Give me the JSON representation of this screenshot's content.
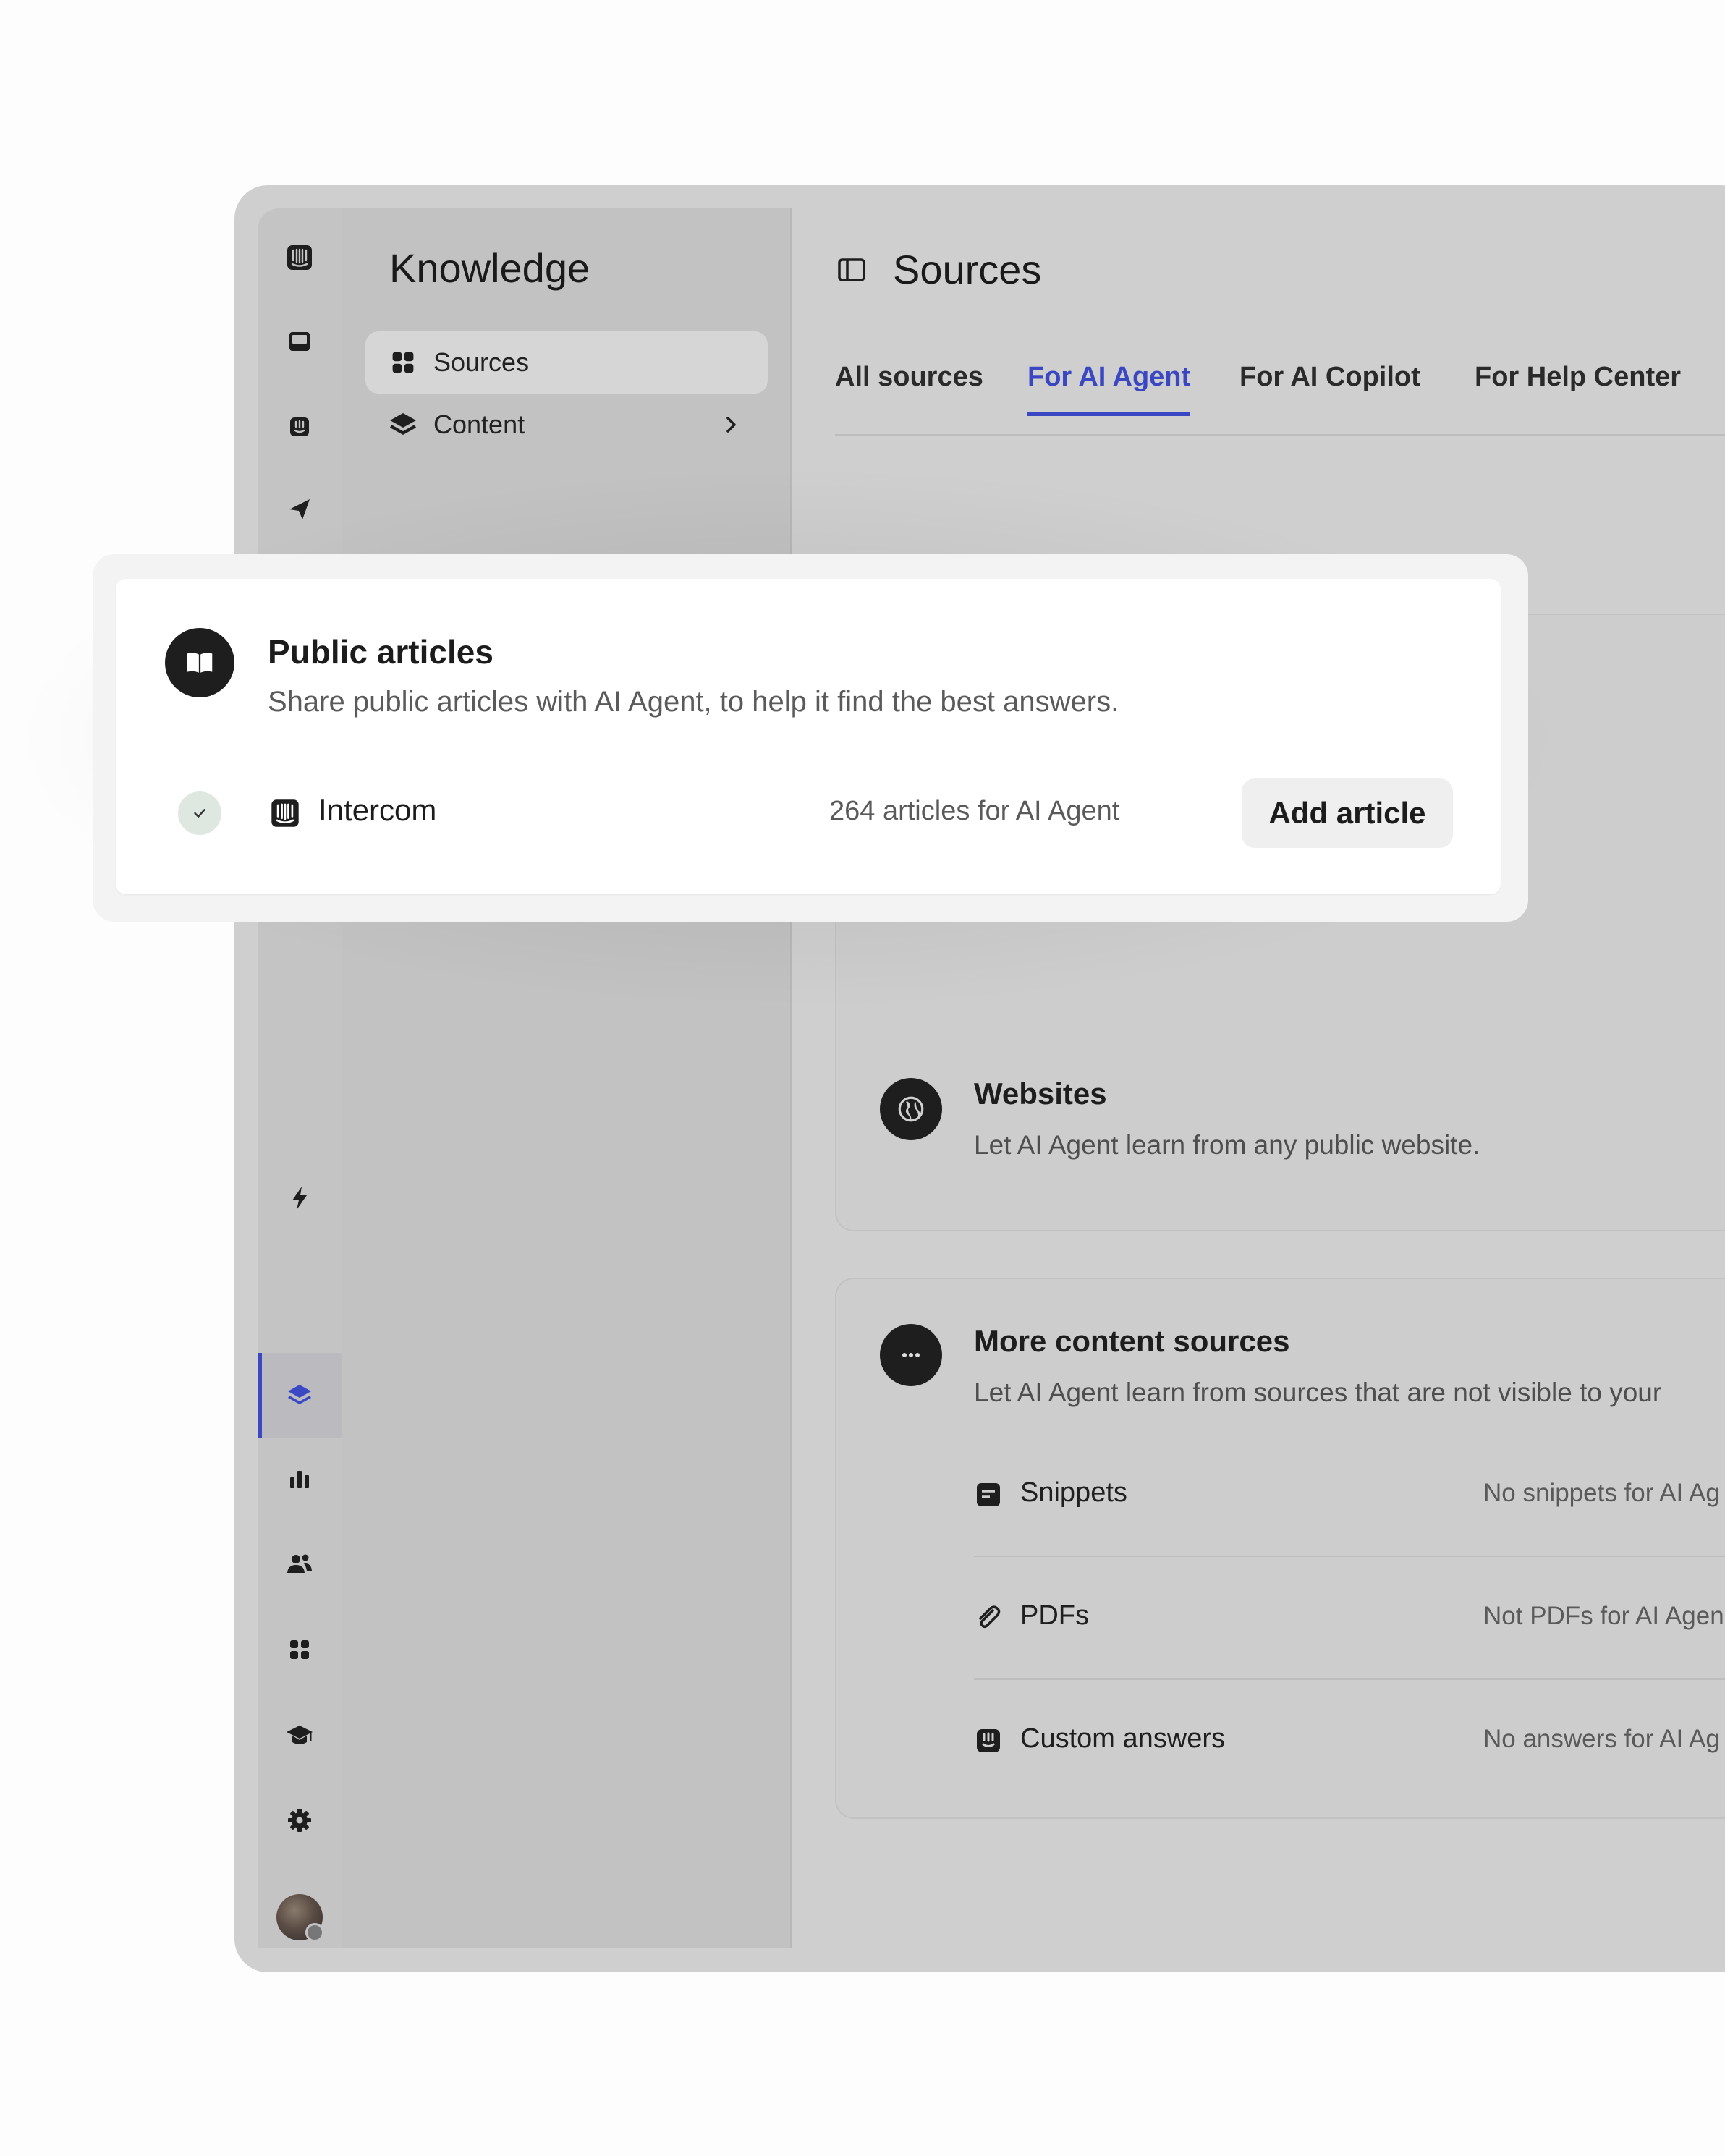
{
  "sidebar": {
    "top_icons": [
      "intercom-logo-icon",
      "inbox-icon",
      "fin-icon",
      "outbound-icon"
    ],
    "bottom_icons": [
      "lightning-icon",
      "knowledge-layers-icon",
      "reports-icon",
      "contacts-icon",
      "apps-icon",
      "academy-icon",
      "settings-icon"
    ],
    "active_item": "knowledge-layers-icon",
    "accent_color": "#3b48c4"
  },
  "nav": {
    "title": "Knowledge",
    "items": [
      {
        "label": "Sources",
        "icon": "grid-icon",
        "selected": true
      },
      {
        "label": "Content",
        "icon": "layers-icon",
        "selected": false
      }
    ]
  },
  "main": {
    "title": "Sources",
    "tabs": [
      {
        "label": "All sources",
        "active": false
      },
      {
        "label": "For AI Agent",
        "active": true
      },
      {
        "label": "For AI Copilot",
        "active": false
      },
      {
        "label": "For Help Center",
        "active": false
      }
    ],
    "websites": {
      "title": "Websites",
      "description": "Let AI Agent learn from any public website.",
      "icon": "globe-icon"
    },
    "more_sources": {
      "title": "More content sources",
      "description": "Let AI Agent learn from sources that are not visible to your",
      "icon": "more-icon",
      "rows": [
        {
          "label": "Snippets",
          "status": "No snippets for AI Ag",
          "icon": "snippet-icon"
        },
        {
          "label": "PDFs",
          "status": "Not PDFs for AI Agen",
          "icon": "paperclip-icon"
        },
        {
          "label": "Custom answers",
          "status": "No answers for AI Ag",
          "icon": "fin-icon"
        }
      ]
    }
  },
  "popup": {
    "title": "Public articles",
    "description": "Share public articles with AI Agent, to help it find the best answers.",
    "icon": "book-icon",
    "source": {
      "name": "Intercom",
      "count_text": "264 articles for AI Agent",
      "connected": true
    },
    "button_label": "Add article"
  }
}
